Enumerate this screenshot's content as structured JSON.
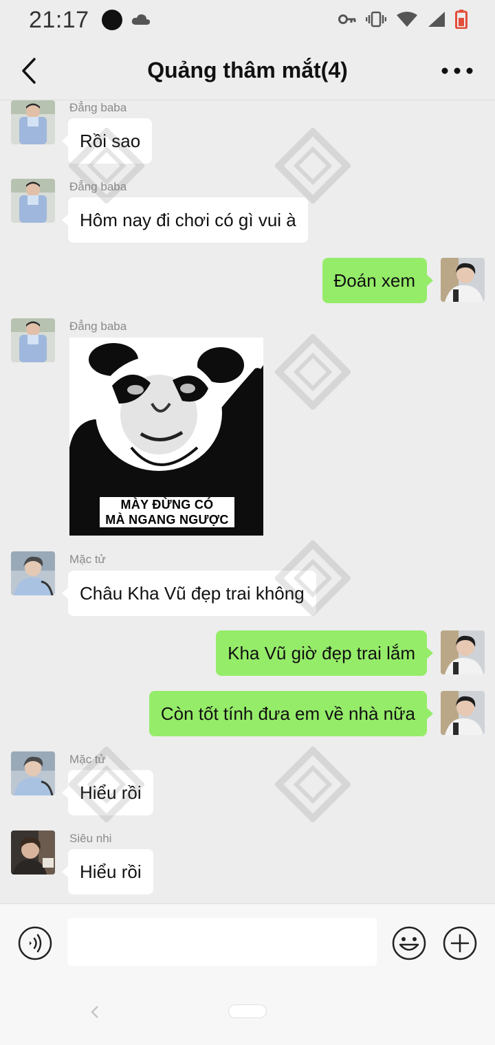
{
  "status": {
    "time": "21:17"
  },
  "header": {
    "title": "Quảng thâm mắt(4)"
  },
  "messages": [
    {
      "sender": "Đẳng baba",
      "text": "Rồi sao"
    },
    {
      "sender": "Đẳng baba",
      "text": "Hôm nay đi chơi có gì vui à"
    },
    {
      "text": "Đoán xem"
    },
    {
      "sender": "Đẳng baba",
      "sticker_caption_1": "MÀY ĐỪNG CÓ",
      "sticker_caption_2": "MÀ NGANG NGƯỢC"
    },
    {
      "sender": "Mặc tử",
      "text": "Châu Kha Vũ đẹp trai không"
    },
    {
      "text": "Kha Vũ giờ đẹp trai lắm"
    },
    {
      "text": "Còn tốt tính đưa em về nhà nữa"
    },
    {
      "sender": "Mặc tử",
      "text": "Hiểu rồi"
    },
    {
      "sender": "Siêu nhi",
      "text": "Hiểu rồi"
    }
  ],
  "input": {
    "placeholder": ""
  },
  "colors": {
    "outgoing_bubble": "#95ec69",
    "incoming_bubble": "#ffffff",
    "background": "#ededed"
  }
}
